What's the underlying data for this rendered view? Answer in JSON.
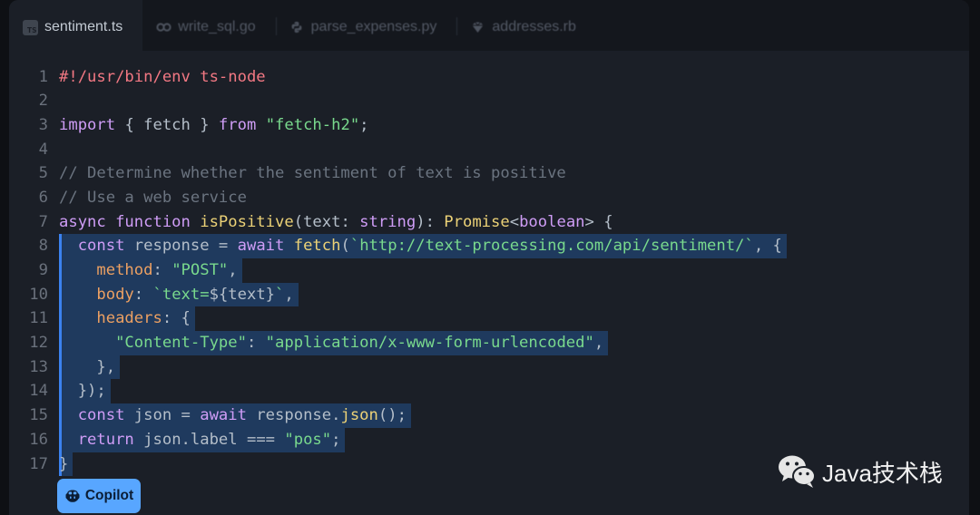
{
  "tabs": [
    {
      "label": "sentiment.ts",
      "icon": "typescript-icon",
      "icon_text": "TS",
      "active": true
    },
    {
      "label": "write_sql.go",
      "icon": "go-icon",
      "active": false
    },
    {
      "label": "parse_expenses.py",
      "icon": "python-icon",
      "active": false
    },
    {
      "label": "addresses.rb",
      "icon": "ruby-icon",
      "active": false
    }
  ],
  "editor": {
    "lines": [
      {
        "number": "1",
        "suggested": false,
        "tokens": [
          {
            "text": "#!/usr/bin/env ts-node",
            "kind": "shebang"
          }
        ]
      },
      {
        "number": "2",
        "suggested": false,
        "tokens": []
      },
      {
        "number": "3",
        "suggested": false,
        "tokens": [
          {
            "text": "import",
            "kind": "keyword"
          },
          {
            "text": " { fetch } ",
            "kind": "plain"
          },
          {
            "text": "from",
            "kind": "keyword"
          },
          {
            "text": " ",
            "kind": "plain"
          },
          {
            "text": "\"fetch-h2\"",
            "kind": "string"
          },
          {
            "text": ";",
            "kind": "plain"
          }
        ]
      },
      {
        "number": "4",
        "suggested": false,
        "tokens": []
      },
      {
        "number": "5",
        "suggested": false,
        "tokens": [
          {
            "text": "// Determine whether the sentiment of text is positive",
            "kind": "comment"
          }
        ]
      },
      {
        "number": "6",
        "suggested": false,
        "tokens": [
          {
            "text": "// Use a web service",
            "kind": "comment"
          }
        ]
      },
      {
        "number": "7",
        "suggested": false,
        "tokens": [
          {
            "text": "async function ",
            "kind": "keyword"
          },
          {
            "text": "isPositive",
            "kind": "function"
          },
          {
            "text": "(text: ",
            "kind": "plain"
          },
          {
            "text": "string",
            "kind": "keyword"
          },
          {
            "text": "): ",
            "kind": "plain"
          },
          {
            "text": "Promise",
            "kind": "function"
          },
          {
            "text": "<",
            "kind": "plain"
          },
          {
            "text": "boolean",
            "kind": "keyword"
          },
          {
            "text": "> {",
            "kind": "plain"
          }
        ]
      },
      {
        "number": "8",
        "suggested": true,
        "tokens": [
          {
            "text": "  const",
            "kind": "keyword"
          },
          {
            "text": " response = ",
            "kind": "plain"
          },
          {
            "text": "await",
            "kind": "keyword"
          },
          {
            "text": " ",
            "kind": "plain"
          },
          {
            "text": "fetch",
            "kind": "function"
          },
          {
            "text": "(",
            "kind": "plain"
          },
          {
            "text": "`http://text-processing.com/api/sentiment/`",
            "kind": "string"
          },
          {
            "text": ", {",
            "kind": "plain"
          }
        ]
      },
      {
        "number": "9",
        "suggested": true,
        "tokens": [
          {
            "text": "    method",
            "kind": "property"
          },
          {
            "text": ": ",
            "kind": "plain"
          },
          {
            "text": "\"POST\"",
            "kind": "string"
          },
          {
            "text": ",",
            "kind": "plain"
          }
        ]
      },
      {
        "number": "10",
        "suggested": true,
        "tokens": [
          {
            "text": "    body",
            "kind": "property"
          },
          {
            "text": ": ",
            "kind": "plain"
          },
          {
            "text": "`text=",
            "kind": "string"
          },
          {
            "text": "${text}",
            "kind": "plain"
          },
          {
            "text": "`",
            "kind": "string"
          },
          {
            "text": ",",
            "kind": "plain"
          }
        ]
      },
      {
        "number": "11",
        "suggested": true,
        "tokens": [
          {
            "text": "    headers",
            "kind": "property"
          },
          {
            "text": ": {",
            "kind": "plain"
          }
        ]
      },
      {
        "number": "12",
        "suggested": true,
        "tokens": [
          {
            "text": "      \"Content-Type\"",
            "kind": "string"
          },
          {
            "text": ": ",
            "kind": "plain"
          },
          {
            "text": "\"application/x-www-form-urlencoded\"",
            "kind": "string"
          },
          {
            "text": ",",
            "kind": "plain"
          }
        ]
      },
      {
        "number": "13",
        "suggested": true,
        "tokens": [
          {
            "text": "    },",
            "kind": "plain"
          }
        ]
      },
      {
        "number": "14",
        "suggested": true,
        "tokens": [
          {
            "text": "  });",
            "kind": "plain"
          }
        ]
      },
      {
        "number": "15",
        "suggested": true,
        "tokens": [
          {
            "text": "  const",
            "kind": "keyword"
          },
          {
            "text": " json = ",
            "kind": "plain"
          },
          {
            "text": "await",
            "kind": "keyword"
          },
          {
            "text": " response.",
            "kind": "plain"
          },
          {
            "text": "json",
            "kind": "function"
          },
          {
            "text": "();",
            "kind": "plain"
          }
        ]
      },
      {
        "number": "16",
        "suggested": true,
        "tokens": [
          {
            "text": "  return",
            "kind": "keyword"
          },
          {
            "text": " json.label === ",
            "kind": "plain"
          },
          {
            "text": "\"pos\"",
            "kind": "string"
          },
          {
            "text": ";",
            "kind": "plain"
          }
        ]
      },
      {
        "number": "17",
        "suggested": true,
        "tokens": [
          {
            "text": "}",
            "kind": "plain"
          }
        ]
      }
    ]
  },
  "copilot_button": {
    "label": "Copilot",
    "icon": "copilot-icon"
  },
  "watermark": {
    "text": "Java技术栈",
    "icon": "wechat-icon"
  },
  "colors": {
    "accent": "#58a6ff",
    "selection": "#1f3a5e",
    "selection_bar": "#3b82f0",
    "syntax": {
      "shebang": "#f27883",
      "keyword": "#cf9df6",
      "function": "#ecd277",
      "string": "#79d98d",
      "property": "#eca062",
      "comment": "#6b7480",
      "plain": "#b4bec9"
    }
  }
}
